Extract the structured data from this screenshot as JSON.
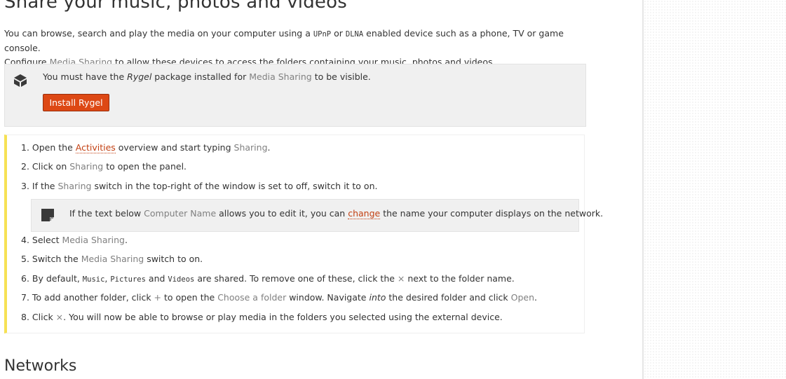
{
  "page": {
    "title": "Share your music, photos and videos",
    "next_section": "Networks"
  },
  "intro": {
    "line1_a": "You can browse, search and play the media on your computer using a ",
    "line1_upnp": "UPnP",
    "line1_or": " or ",
    "line1_dlna": "DLNA",
    "line1_b": " enabled device such as a phone, TV or game console.",
    "line2_a": "Configure ",
    "line2_gui": "Media Sharing",
    "line2_b": " to allow these devices to access the folders containing your music, photos and videos."
  },
  "note": {
    "icon": "package-icon",
    "text_a": "You must have the ",
    "package_name": "Rygel",
    "text_b": " package installed for ",
    "gui": "Media Sharing",
    "text_c": " to be visible.",
    "button_label": "Install Rygel"
  },
  "steps": [
    {
      "num": "1.",
      "a": " Open the ",
      "link": "Activities",
      "b": " overview and start typing ",
      "gui": "Sharing",
      "c": "."
    },
    {
      "num": "2.",
      "a": " Click on ",
      "gui": "Sharing",
      "b": " to open the panel."
    },
    {
      "num": "3.",
      "a": " If the ",
      "gui": "Sharing",
      "b": " switch in the top-right of the window is set to off, switch it to on."
    },
    {
      "num": "4.",
      "a": " Select ",
      "gui": "Media Sharing",
      "b": "."
    },
    {
      "num": "5.",
      "a": " Switch the ",
      "gui": "Media Sharing",
      "b": " switch to on."
    },
    {
      "num": "6.",
      "a": " By default, ",
      "code1": "Music",
      "sep1": ", ",
      "code2": "Pictures",
      "sep2": " and ",
      "code3": "Videos",
      "b": " are shared. To remove one of these, click the ",
      "gui": "×",
      "c": " next to the folder name."
    },
    {
      "num": "7.",
      "a": " To add another folder, click ",
      "gui1": "+",
      "b": " to open the ",
      "gui2": "Choose a folder",
      "c": " window. Navigate ",
      "em": "into",
      "d": " the desired folder and click ",
      "gui3": "Open",
      "e": "."
    },
    {
      "num": "8.",
      "a": " Click ",
      "gui": "×",
      "b": ". You will now be able to browse or play media in the folders you selected using the external device."
    }
  ],
  "inner_note": {
    "icon": "note-icon",
    "a": "If the text below ",
    "gui": "Computer Name",
    "b": " allows you to edit it, you can ",
    "link": "change",
    "c": " the name your computer displays on the network."
  },
  "colors": {
    "link": "#c34113",
    "gui": "#808080",
    "button": "#dd4814",
    "steps_accent": "#f6e154"
  }
}
